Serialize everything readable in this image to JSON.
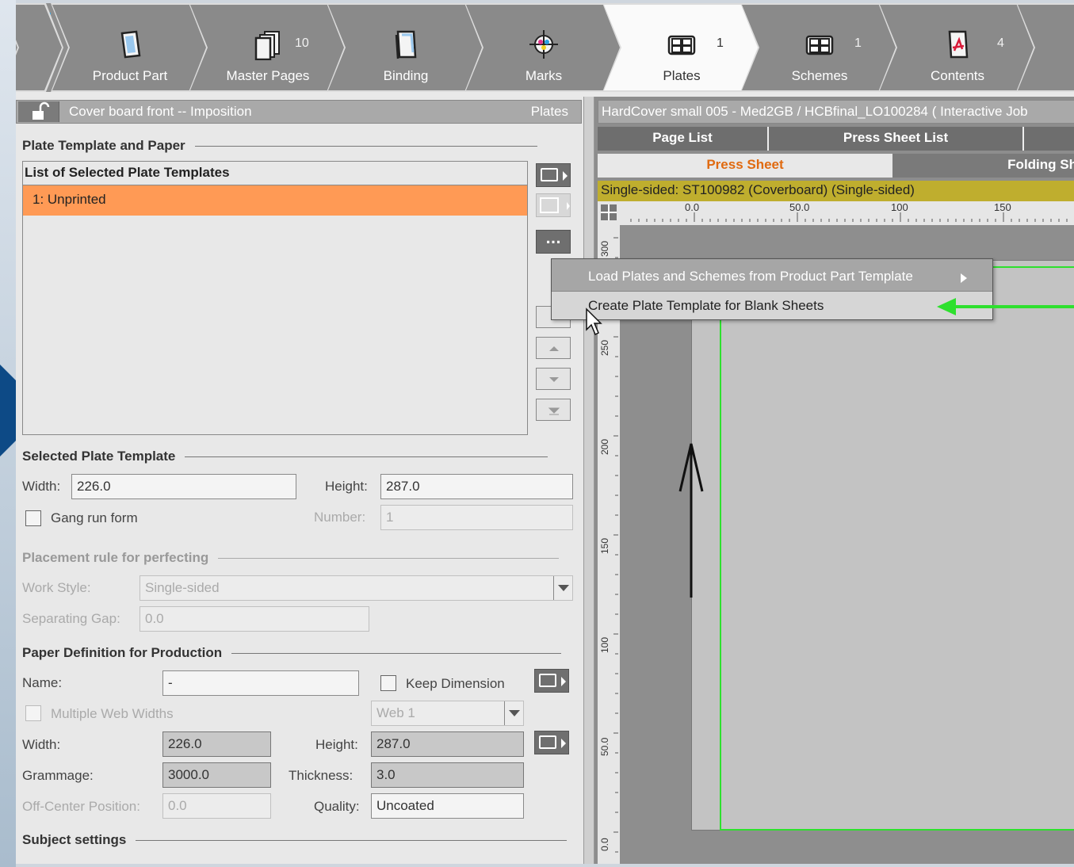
{
  "nav": {
    "steps": [
      {
        "label": "Product Part",
        "count": ""
      },
      {
        "label": "Master Pages",
        "count": "10"
      },
      {
        "label": "Binding",
        "count": ""
      },
      {
        "label": "Marks",
        "count": ""
      },
      {
        "label": "Plates",
        "count": "1"
      },
      {
        "label": "Schemes",
        "count": "1"
      },
      {
        "label": "Contents",
        "count": "4"
      }
    ],
    "active": "Plates"
  },
  "left": {
    "header_title": "Cover board front -- Imposition",
    "header_right": "Plates",
    "sec_plate_paper": "Plate Template and Paper",
    "list_header": "List of Selected Plate Templates",
    "list_items": [
      "1: Unprinted"
    ],
    "sec_selected": "Selected Plate Template",
    "width_label": "Width:",
    "width_value": "226.0",
    "height_label": "Height:",
    "height_value": "287.0",
    "gang_label": "Gang run form",
    "number_label": "Number:",
    "number_value": "1",
    "sec_placement": "Placement rule for perfecting",
    "workstyle_label": "Work Style:",
    "workstyle_value": "Single-sided",
    "gap_label": "Separating Gap:",
    "gap_value": "0.0",
    "sec_paper": "Paper Definition for Production",
    "name_label": "Name:",
    "name_value": "-",
    "keep_label": "Keep Dimension",
    "multiweb_label": "Multiple Web Widths",
    "web_value": "Web 1",
    "pwidth_label": "Width:",
    "pwidth_value": "226.0",
    "pheight_label": "Height:",
    "pheight_value": "287.0",
    "gram_label": "Grammage:",
    "gram_value": "3000.0",
    "thick_label": "Thickness:",
    "thick_value": "3.0",
    "offc_label": "Off-Center Position:",
    "offc_value": "0.0",
    "quality_label": "Quality:",
    "quality_value": "Uncoated",
    "sec_subject": "Subject settings"
  },
  "menu": {
    "more_button": "...",
    "item1": "Load Plates and Schemes from Product Part Template",
    "item2": "Create Plate Template for Blank Sheets"
  },
  "right": {
    "header": "HardCover small 005 - Med2GB / HCBfinal_LO100284 ( Interactive Job",
    "tabs": [
      "Page List",
      "Press Sheet List"
    ],
    "subtabs": [
      "Press Sheet",
      "Folding Sh"
    ],
    "info": "Single-sided:  ST100982 (Coverboard) (Single-sided)",
    "hticks": [
      "0.0",
      "50.0",
      "100",
      "150"
    ],
    "vticks": [
      "300",
      "250",
      "200",
      "150",
      "100",
      "50.0",
      "0.0"
    ]
  },
  "colors": {
    "accent": "#ff9a55",
    "active_tab_text": "#e06a10",
    "info_bar": "#bfae2e",
    "highlight_arrow": "#2ee02e"
  }
}
